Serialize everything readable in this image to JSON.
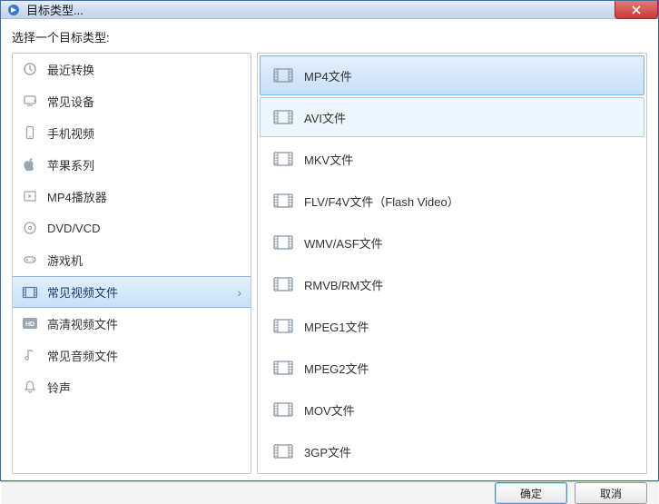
{
  "titlebar": {
    "title": "目标类型..."
  },
  "prompt": "选择一个目标类型:",
  "categories": [
    {
      "label": "最近转换",
      "icon": "clock-icon"
    },
    {
      "label": "常见设备",
      "icon": "device-icon"
    },
    {
      "label": "手机视频",
      "icon": "phone-icon"
    },
    {
      "label": "苹果系列",
      "icon": "apple-icon"
    },
    {
      "label": "MP4播放器",
      "icon": "player-icon"
    },
    {
      "label": "DVD/VCD",
      "icon": "disc-icon"
    },
    {
      "label": "游戏机",
      "icon": "gamepad-icon"
    },
    {
      "label": "常见视频文件",
      "icon": "film-icon",
      "selected": true
    },
    {
      "label": "高清视频文件",
      "icon": "hd-icon"
    },
    {
      "label": "常见音频文件",
      "icon": "music-icon"
    },
    {
      "label": "铃声",
      "icon": "bell-icon"
    }
  ],
  "formats": [
    {
      "label": "MP4文件",
      "selected": true
    },
    {
      "label": "AVI文件",
      "hover": true
    },
    {
      "label": "MKV文件"
    },
    {
      "label": "FLV/F4V文件（Flash Video）"
    },
    {
      "label": "WMV/ASF文件"
    },
    {
      "label": "RMVB/RM文件"
    },
    {
      "label": "MPEG1文件"
    },
    {
      "label": "MPEG2文件"
    },
    {
      "label": "MOV文件"
    },
    {
      "label": "3GP文件"
    }
  ],
  "buttons": {
    "ok": "确定",
    "cancel": "取消"
  }
}
